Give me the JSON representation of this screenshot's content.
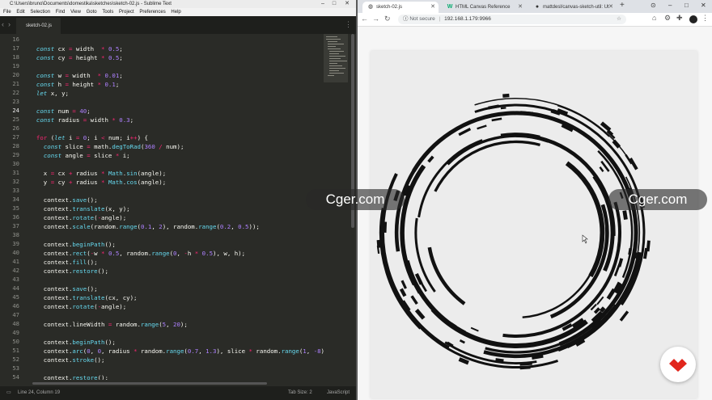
{
  "sublime": {
    "title": "C:\\Users\\bruno\\Documents\\domestika\\sketches\\sketch-02.js - Sublime Text",
    "menu": [
      "File",
      "Edit",
      "Selection",
      "Find",
      "View",
      "Goto",
      "Tools",
      "Project",
      "Preferences",
      "Help"
    ],
    "tab": "sketch-02.js",
    "status_left": "Line 24, Column 19",
    "status_tab": "Tab Size: 2",
    "status_lang": "JavaScript",
    "current_line": 24,
    "lines": [
      {
        "n": "16",
        "t": []
      },
      {
        "n": "17",
        "t": [
          [
            "  "
          ],
          [
            "const",
            "kw"
          ],
          [
            " cx "
          ],
          [
            "=",
            "op"
          ],
          [
            " width  "
          ],
          [
            "*",
            "op"
          ],
          [
            " "
          ],
          [
            "0.5",
            "num"
          ],
          [
            ";"
          ]
        ]
      },
      {
        "n": "18",
        "t": [
          [
            "  "
          ],
          [
            "const",
            "kw"
          ],
          [
            " cy "
          ],
          [
            "=",
            "op"
          ],
          [
            " height "
          ],
          [
            "*",
            "op"
          ],
          [
            " "
          ],
          [
            "0.5",
            "num"
          ],
          [
            ";"
          ]
        ]
      },
      {
        "n": "19",
        "t": []
      },
      {
        "n": "20",
        "t": [
          [
            "  "
          ],
          [
            "const",
            "kw"
          ],
          [
            " w "
          ],
          [
            "=",
            "op"
          ],
          [
            " width  "
          ],
          [
            "*",
            "op"
          ],
          [
            " "
          ],
          [
            "0.01",
            "num"
          ],
          [
            ";"
          ]
        ]
      },
      {
        "n": "21",
        "t": [
          [
            "  "
          ],
          [
            "const",
            "kw"
          ],
          [
            " h "
          ],
          [
            "=",
            "op"
          ],
          [
            " height "
          ],
          [
            "*",
            "op"
          ],
          [
            " "
          ],
          [
            "0.1",
            "num"
          ],
          [
            ";"
          ]
        ]
      },
      {
        "n": "22",
        "t": [
          [
            "  "
          ],
          [
            "let",
            "kw"
          ],
          [
            " x, y;"
          ]
        ]
      },
      {
        "n": "23",
        "t": []
      },
      {
        "n": "24",
        "t": [
          [
            "  "
          ],
          [
            "const",
            "kw"
          ],
          [
            " num "
          ],
          [
            "=",
            "op"
          ],
          [
            " "
          ],
          [
            "40",
            "num"
          ],
          [
            ";"
          ]
        ]
      },
      {
        "n": "25",
        "t": [
          [
            "  "
          ],
          [
            "const",
            "kw"
          ],
          [
            " radius "
          ],
          [
            "=",
            "op"
          ],
          [
            " width "
          ],
          [
            "*",
            "op"
          ],
          [
            " "
          ],
          [
            "0.3",
            "num"
          ],
          [
            ";"
          ]
        ]
      },
      {
        "n": "26",
        "t": []
      },
      {
        "n": "27",
        "t": [
          [
            "  "
          ],
          [
            "for",
            "kf"
          ],
          [
            " ("
          ],
          [
            "let",
            "kw"
          ],
          [
            " i "
          ],
          [
            "=",
            "op"
          ],
          [
            " "
          ],
          [
            "0",
            "num"
          ],
          [
            "; i "
          ],
          [
            "<",
            "op"
          ],
          [
            " num; i"
          ],
          [
            "++",
            "op"
          ],
          [
            ") {"
          ]
        ]
      },
      {
        "n": "28",
        "t": [
          [
            "    "
          ],
          [
            "const",
            "kw"
          ],
          [
            " slice "
          ],
          [
            "=",
            "op"
          ],
          [
            " math."
          ],
          [
            "degToRad",
            "fn"
          ],
          [
            "("
          ],
          [
            "360",
            "num"
          ],
          [
            " "
          ],
          [
            "/",
            "op"
          ],
          [
            " num);"
          ]
        ]
      },
      {
        "n": "29",
        "t": [
          [
            "    "
          ],
          [
            "const",
            "kw"
          ],
          [
            " angle "
          ],
          [
            "=",
            "op"
          ],
          [
            " slice "
          ],
          [
            "*",
            "op"
          ],
          [
            " i;"
          ]
        ]
      },
      {
        "n": "30",
        "t": []
      },
      {
        "n": "31",
        "t": [
          [
            "    x "
          ],
          [
            "=",
            "op"
          ],
          [
            " cx "
          ],
          [
            "+",
            "op"
          ],
          [
            " radius "
          ],
          [
            "*",
            "op"
          ],
          [
            " "
          ],
          [
            "Math",
            "cons"
          ],
          [
            "."
          ],
          [
            "sin",
            "fn"
          ],
          [
            "(angle);"
          ]
        ]
      },
      {
        "n": "32",
        "t": [
          [
            "    y "
          ],
          [
            "=",
            "op"
          ],
          [
            " cy "
          ],
          [
            "+",
            "op"
          ],
          [
            " radius "
          ],
          [
            "*",
            "op"
          ],
          [
            " "
          ],
          [
            "Math",
            "cons"
          ],
          [
            "."
          ],
          [
            "cos",
            "fn"
          ],
          [
            "(angle);"
          ]
        ]
      },
      {
        "n": "33",
        "t": []
      },
      {
        "n": "34",
        "t": [
          [
            "    context."
          ],
          [
            "save",
            "fn"
          ],
          [
            "();"
          ]
        ]
      },
      {
        "n": "35",
        "t": [
          [
            "    context."
          ],
          [
            "translate",
            "fn"
          ],
          [
            "(x, y);"
          ]
        ]
      },
      {
        "n": "36",
        "t": [
          [
            "    context."
          ],
          [
            "rotate",
            "fn"
          ],
          [
            "("
          ],
          [
            "-",
            "op"
          ],
          [
            "angle);"
          ]
        ]
      },
      {
        "n": "37",
        "t": [
          [
            "    context."
          ],
          [
            "scale",
            "fn"
          ],
          [
            "(random."
          ],
          [
            "range",
            "fn"
          ],
          [
            "("
          ],
          [
            "0.1",
            "num"
          ],
          [
            ", "
          ],
          [
            "2",
            "num"
          ],
          [
            "), random."
          ],
          [
            "range",
            "fn"
          ],
          [
            "("
          ],
          [
            "0.2",
            "num"
          ],
          [
            ", "
          ],
          [
            "0.5",
            "num"
          ],
          [
            "));"
          ]
        ]
      },
      {
        "n": "38",
        "t": []
      },
      {
        "n": "39",
        "t": [
          [
            "    context."
          ],
          [
            "beginPath",
            "fn"
          ],
          [
            "();"
          ]
        ]
      },
      {
        "n": "40",
        "t": [
          [
            "    context."
          ],
          [
            "rect",
            "fn"
          ],
          [
            "("
          ],
          [
            "-",
            "op"
          ],
          [
            "w "
          ],
          [
            "*",
            "op"
          ],
          [
            " "
          ],
          [
            "0.5",
            "num"
          ],
          [
            ", random."
          ],
          [
            "range",
            "fn"
          ],
          [
            "("
          ],
          [
            "0",
            "num"
          ],
          [
            ", "
          ],
          [
            "-",
            "op"
          ],
          [
            "h "
          ],
          [
            "*",
            "op"
          ],
          [
            " "
          ],
          [
            "0.5",
            "num"
          ],
          [
            "), w, h);"
          ]
        ]
      },
      {
        "n": "41",
        "t": [
          [
            "    context."
          ],
          [
            "fill",
            "fn"
          ],
          [
            "();"
          ]
        ]
      },
      {
        "n": "42",
        "t": [
          [
            "    context."
          ],
          [
            "restore",
            "fn"
          ],
          [
            "();"
          ]
        ]
      },
      {
        "n": "43",
        "t": []
      },
      {
        "n": "44",
        "t": [
          [
            "    context."
          ],
          [
            "save",
            "fn"
          ],
          [
            "();"
          ]
        ]
      },
      {
        "n": "45",
        "t": [
          [
            "    context."
          ],
          [
            "translate",
            "fn"
          ],
          [
            "(cx, cy);"
          ]
        ]
      },
      {
        "n": "46",
        "t": [
          [
            "    context."
          ],
          [
            "rotate",
            "fn"
          ],
          [
            "("
          ],
          [
            "-",
            "op"
          ],
          [
            "angle);"
          ]
        ]
      },
      {
        "n": "47",
        "t": []
      },
      {
        "n": "48",
        "t": [
          [
            "    context.lineWidth "
          ],
          [
            "=",
            "op"
          ],
          [
            " random."
          ],
          [
            "range",
            "fn"
          ],
          [
            "("
          ],
          [
            "5",
            "num"
          ],
          [
            ", "
          ],
          [
            "20",
            "num"
          ],
          [
            ");"
          ]
        ]
      },
      {
        "n": "49",
        "t": []
      },
      {
        "n": "50",
        "t": [
          [
            "    context."
          ],
          [
            "beginPath",
            "fn"
          ],
          [
            "();"
          ]
        ]
      },
      {
        "n": "51",
        "t": [
          [
            "    context."
          ],
          [
            "arc",
            "fn"
          ],
          [
            "("
          ],
          [
            "0",
            "num"
          ],
          [
            ", "
          ],
          [
            "0",
            "num"
          ],
          [
            ", radius "
          ],
          [
            "*",
            "op"
          ],
          [
            " random."
          ],
          [
            "range",
            "fn"
          ],
          [
            "("
          ],
          [
            "0.7",
            "num"
          ],
          [
            ", "
          ],
          [
            "1.3",
            "num"
          ],
          [
            "), slice "
          ],
          [
            "*",
            "op"
          ],
          [
            " random."
          ],
          [
            "range",
            "fn"
          ],
          [
            "("
          ],
          [
            "1",
            "num"
          ],
          [
            ", "
          ],
          [
            "-8",
            "num"
          ],
          [
            "), sl"
          ]
        ]
      },
      {
        "n": "52",
        "t": [
          [
            "    context."
          ],
          [
            "stroke",
            "fn"
          ],
          [
            "();"
          ]
        ]
      },
      {
        "n": "53",
        "t": []
      },
      {
        "n": "54",
        "t": [
          [
            "    context."
          ],
          [
            "restore",
            "fn"
          ],
          [
            "();"
          ]
        ]
      }
    ]
  },
  "chrome": {
    "tabs": [
      {
        "label": "sketch-02.js",
        "icon": "globe-icon"
      },
      {
        "label": "HTML Canvas Reference",
        "icon": "w3-icon"
      },
      {
        "label": "mattdesl/canvas-sketch-util: Ut",
        "icon": "github-icon"
      }
    ],
    "new_tab": "+",
    "not_secure": "Not secure",
    "url": "192.168.1.179:9966"
  },
  "watermark": "Cger.com",
  "colors": {
    "sublime_bg": "#2a2b27",
    "keyword": "#66d9ef",
    "operator": "#f92672",
    "number": "#ae81ff",
    "canvas_bg": "#ececec",
    "fab_logo": "#e1261c"
  }
}
